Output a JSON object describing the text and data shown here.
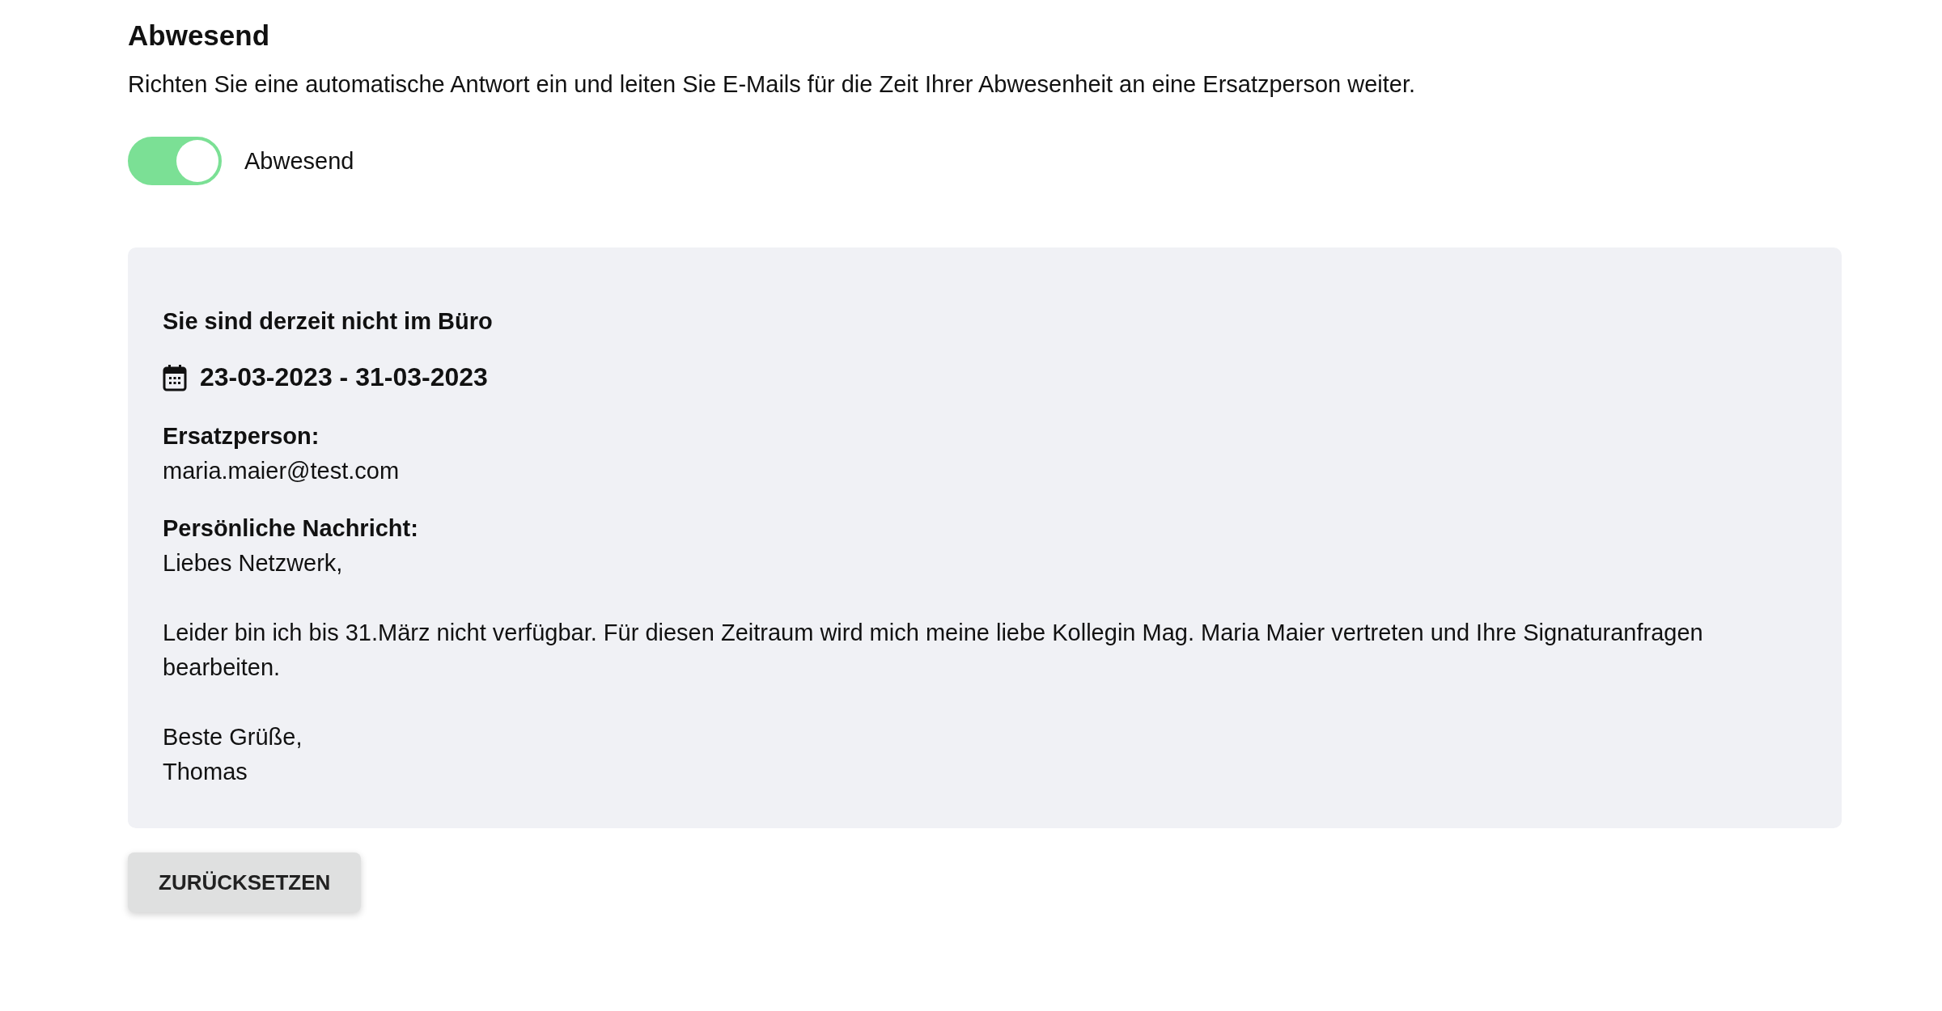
{
  "title": "Abwesend",
  "description": "Richten Sie eine automatische Antwort ein und leiten Sie E-Mails für die Zeit Ihrer Abwesenheit an eine Ersatzperson weiter.",
  "toggle": {
    "label": "Abwesend",
    "on": true
  },
  "panel": {
    "heading": "Sie sind derzeit nicht im Büro",
    "date_range": "23-03-2023 - 31-03-2023",
    "substitute_label": "Ersatzperson:",
    "substitute": "maria.maier@test.com",
    "message_label": "Persönliche Nachricht:",
    "message": [
      "Liebes Netzwerk,",
      "Leider bin ich bis 31.März nicht verfügbar. Für diesen Zeitraum wird mich meine liebe Kollegin Mag. Maria Maier vertreten und Ihre Signaturanfragen bearbeiten.",
      "Beste Grüße,\nThomas"
    ]
  },
  "reset_button": "ZURÜCKSETZEN"
}
